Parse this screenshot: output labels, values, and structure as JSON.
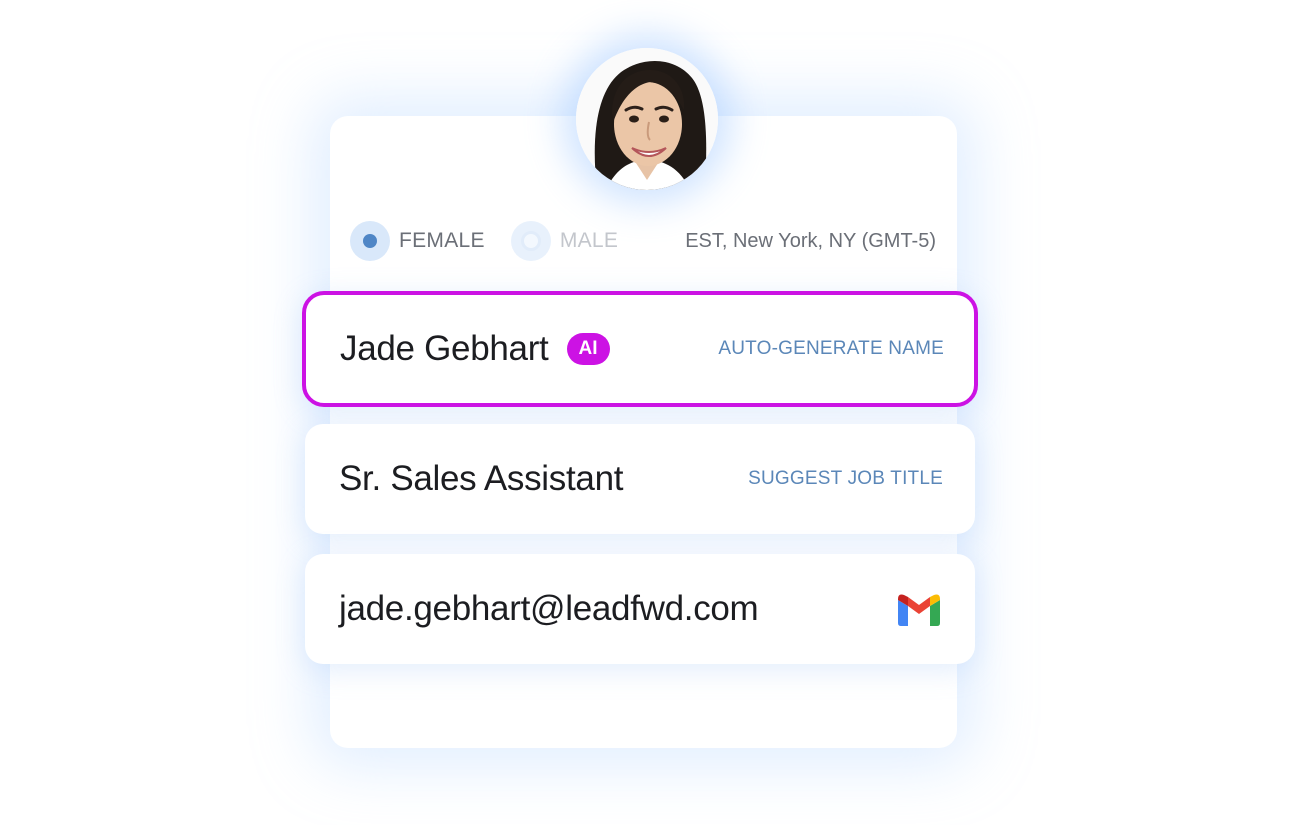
{
  "profile": {
    "avatar_alt": "Profile photo",
    "gender": {
      "options": [
        {
          "label": "FEMALE",
          "selected": true
        },
        {
          "label": "MALE",
          "selected": false
        }
      ]
    },
    "timezone": "EST, New York, NY (GMT-5)"
  },
  "fields": {
    "name": {
      "value": "Jade Gebhart",
      "badge": "AI",
      "action": "AUTO-GENERATE NAME"
    },
    "job_title": {
      "value": "Sr. Sales Assistant",
      "action": "SUGGEST JOB TITLE"
    },
    "email": {
      "value": "jade.gebhart@leadfwd.com",
      "icon": "gmail-icon"
    }
  },
  "colors": {
    "accent": "#cc12e4",
    "link": "#5b87b8",
    "radio_selected": "#4f86c6"
  }
}
